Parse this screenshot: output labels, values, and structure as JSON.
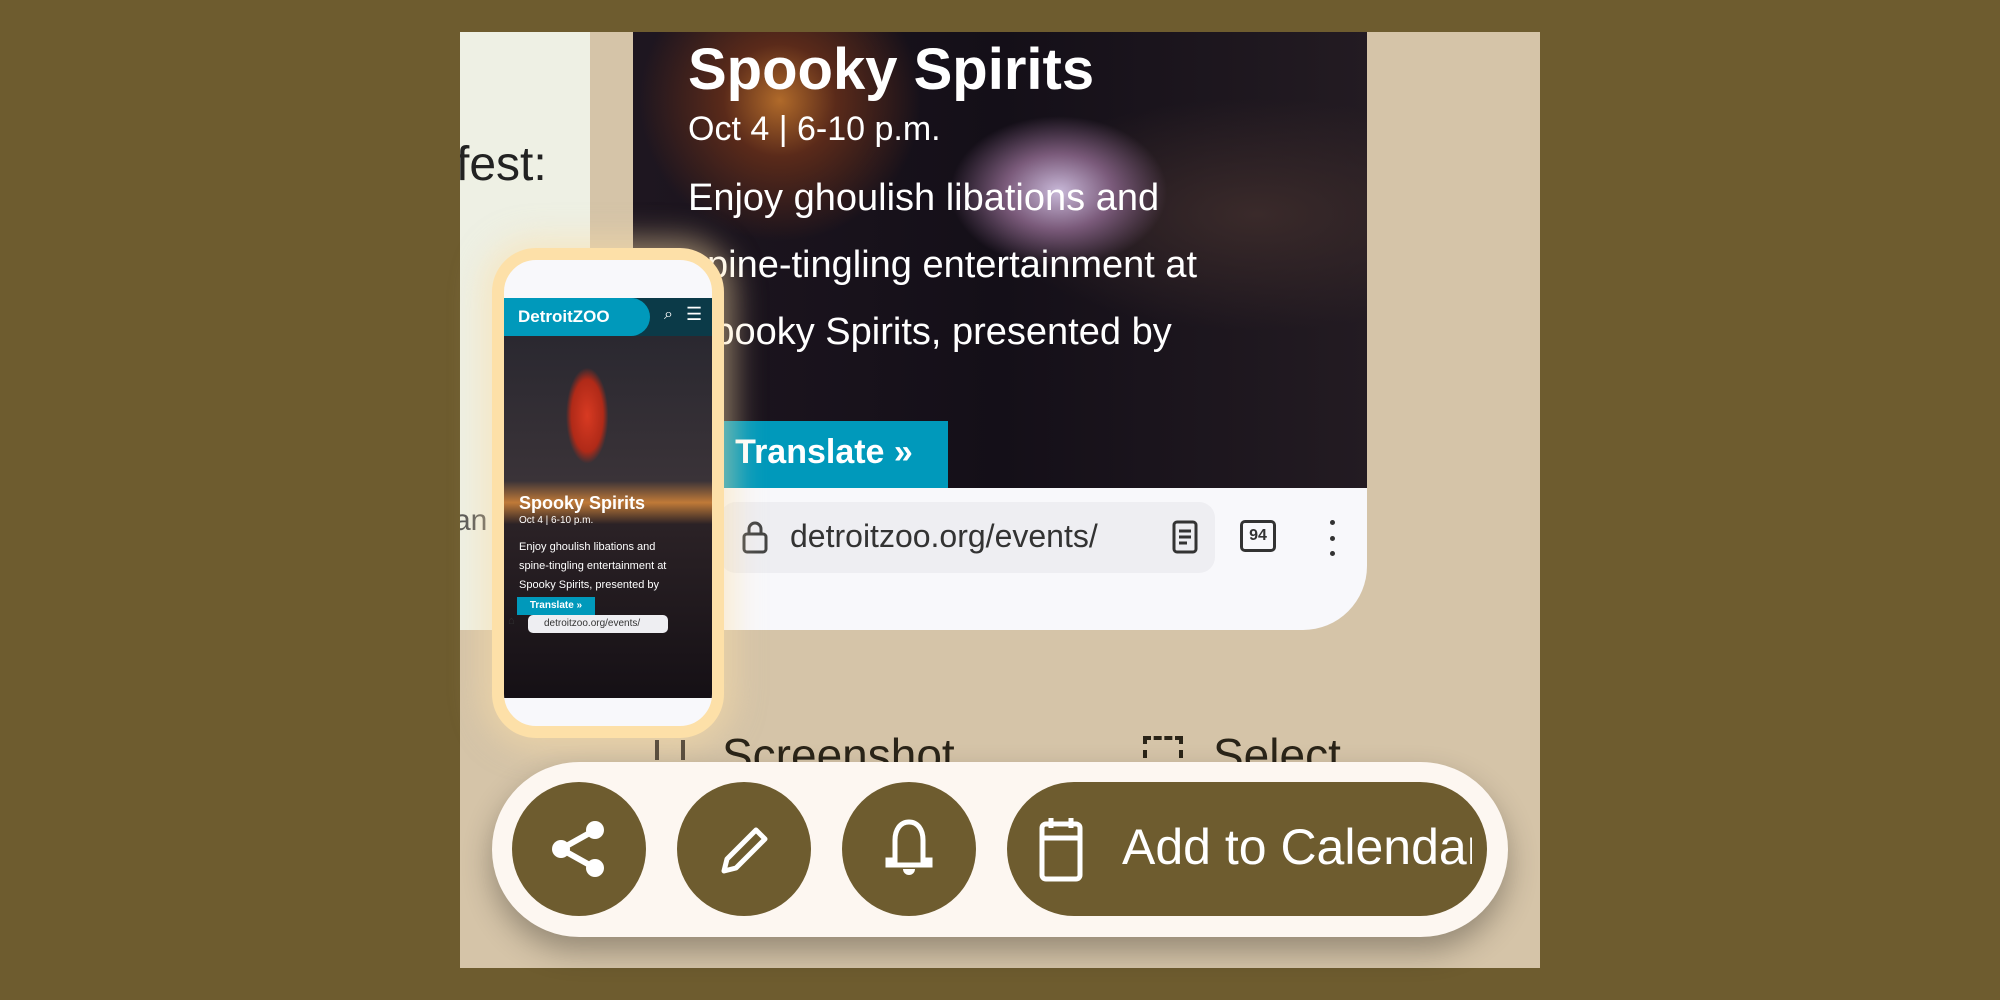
{
  "colors": {
    "background": "#6e5c2f",
    "panel": "#d5c4a8",
    "accent": "#0099bb",
    "pill": "#fdf7f1"
  },
  "left_card": {
    "text1": "fest:",
    "text2": "an"
  },
  "screenshot": {
    "title": "Spooky Spirits",
    "date": "Oct 4 | 6-10 p.m.",
    "body": [
      "Enjoy ghoulish libations and",
      "spine-tingling entertainment at",
      "Spooky Spirits, presented by"
    ],
    "translate": "Translate »",
    "url": "detroitzoo.org/events/",
    "tab_count": "94"
  },
  "phone": {
    "logo": "DetroitZOO",
    "title": "Spooky Spirits",
    "date": "Oct 4 | 6-10 p.m.",
    "body": [
      "Enjoy ghoulish libations and",
      "spine-tingling entertainment at",
      "Spooky Spirits, presented by"
    ],
    "translate": "Translate »",
    "url": "detroitzoo.org/events/"
  },
  "actions": {
    "screenshot": "Screenshot",
    "select": "Select"
  },
  "toolbar": {
    "icons": [
      "share-icon",
      "pencil-icon",
      "bell-icon",
      "calendar-icon"
    ],
    "add_to_calendar": "Add to Calendar"
  }
}
